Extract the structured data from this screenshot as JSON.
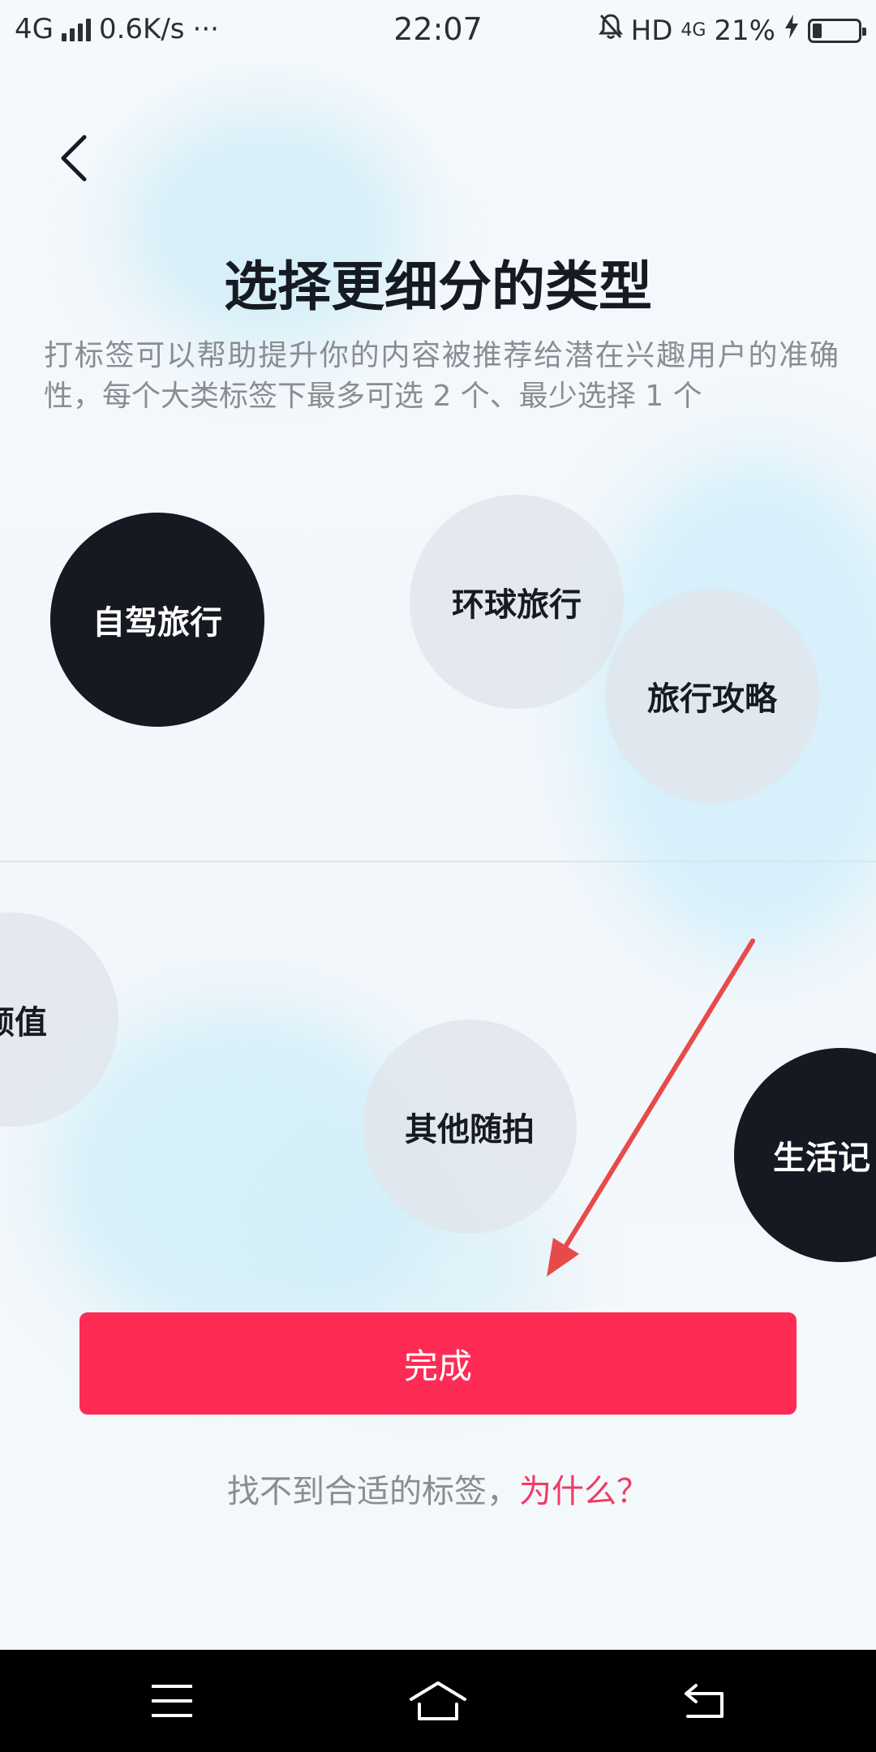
{
  "status_bar": {
    "network": "4G",
    "speed": "0.6K/s",
    "more": "···",
    "time": "22:07",
    "hd": "HD",
    "network_right": "4G",
    "battery": "21%",
    "battery_level": 0.21
  },
  "header": {
    "back_icon": "chevron-left-icon"
  },
  "title": "选择更细分的类型",
  "subtitle": "打标签可以帮助提升你的内容被推荐给潜在兴趣用户的准确性，每个大类标签下最多可选 2 个、最少选择 1 个",
  "tags": [
    {
      "label": "自驾旅行",
      "selected": true
    },
    {
      "label": "环球旅行",
      "selected": false
    },
    {
      "label": "旅行攻略",
      "selected": false
    },
    {
      "label": "颜值",
      "selected": false
    },
    {
      "label": "其他随拍",
      "selected": false
    },
    {
      "label": "生活记",
      "selected": true
    }
  ],
  "done_button": {
    "label": "完成"
  },
  "help": {
    "text": "找不到合适的标签，",
    "link": "为什么？"
  },
  "colors": {
    "accent": "#fe2c55",
    "selected_tag": "#161822",
    "unselected_tag": "#e0e6ec",
    "link": "#f23a64",
    "annotation_arrow": "#e84a4a"
  },
  "nav_bar": {
    "menu_icon": "menu-icon",
    "home_icon": "home-icon",
    "back_icon": "return-icon"
  }
}
